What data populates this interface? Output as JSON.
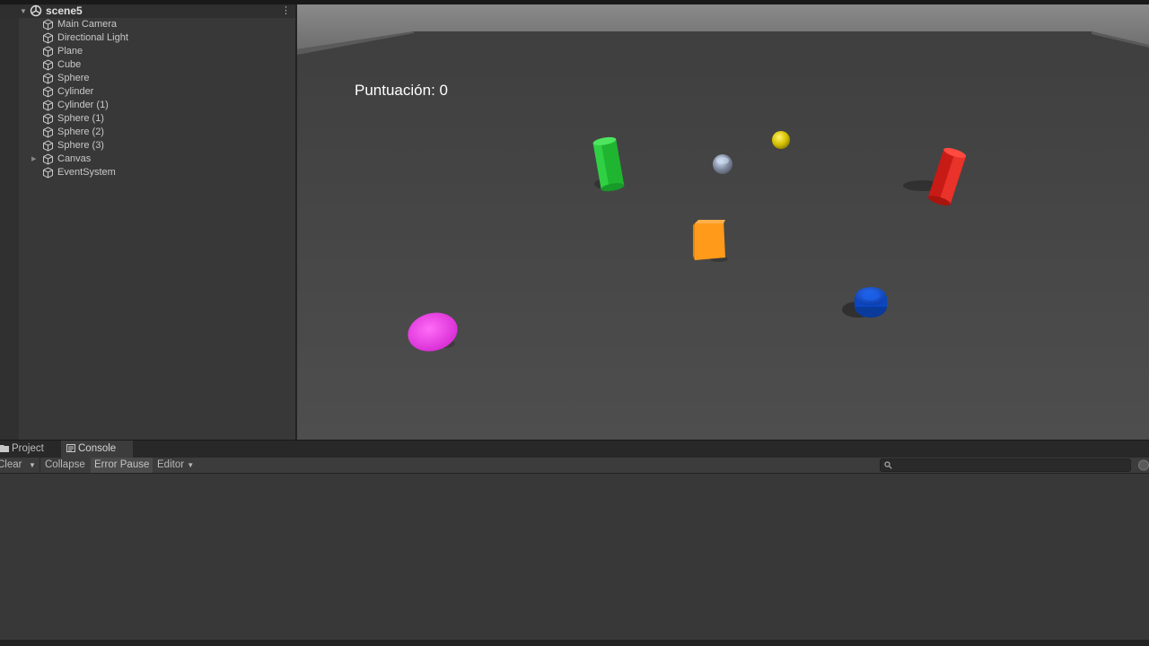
{
  "hierarchy": {
    "scene_name": "scene5",
    "items": [
      {
        "label": "Main Camera",
        "expandable": false
      },
      {
        "label": "Directional Light",
        "expandable": false
      },
      {
        "label": "Plane",
        "expandable": false
      },
      {
        "label": "Cube",
        "expandable": false
      },
      {
        "label": "Sphere",
        "expandable": false
      },
      {
        "label": "Cylinder",
        "expandable": false
      },
      {
        "label": "Cylinder (1)",
        "expandable": false
      },
      {
        "label": "Sphere (1)",
        "expandable": false
      },
      {
        "label": "Sphere (2)",
        "expandable": false
      },
      {
        "label": "Sphere (3)",
        "expandable": false
      },
      {
        "label": "Canvas",
        "expandable": true
      },
      {
        "label": "EventSystem",
        "expandable": false
      }
    ]
  },
  "game": {
    "score_text": "Puntuación: 0",
    "colors": {
      "ground": "#474747",
      "sky": "#7d7d7d",
      "green_cylinder": "#27c238",
      "red_cylinder": "#e0231c",
      "yellow_sphere": "#d8c600",
      "orange_cube": "#ff9a1a",
      "magenta_sphere": "#ee35e6",
      "blue_cylinder": "#0c4fd3",
      "player_ball": "#a0a8b8"
    }
  },
  "bottom_panel": {
    "tabs": [
      {
        "label": "Project",
        "icon": "folder-icon"
      },
      {
        "label": "Console",
        "icon": "console-icon"
      }
    ],
    "toolbar": {
      "clear": "Clear",
      "collapse": "Collapse",
      "error_pause": "Error Pause",
      "editor": "Editor"
    },
    "search_placeholder": ""
  }
}
